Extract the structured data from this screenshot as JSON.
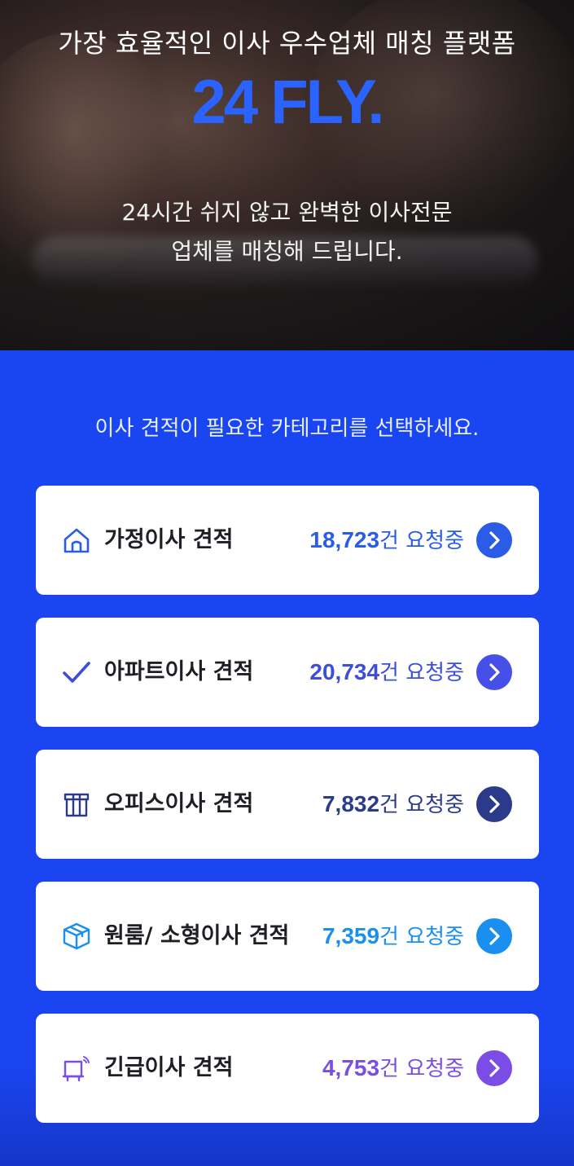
{
  "hero": {
    "tagline": "가장 효율적인 이사 우수업체 매칭 플랫폼",
    "logo": "24 FLY.",
    "description_line1": "24시간 쉬지 않고 완벽한 이사전문",
    "description_line2": "업체를 매칭해 드립니다."
  },
  "section": {
    "title": "이사 견적이 필요한 카테고리를 선택하세요."
  },
  "categories": [
    {
      "label": "가정이사 견적",
      "count": "18,723",
      "unit": "건 요청중",
      "icon": "house-icon",
      "color": "#2a5ce8",
      "arrow_color": "#2a5ce8"
    },
    {
      "label": "아파트이사 견적",
      "count": "20,734",
      "unit": "건 요청중",
      "icon": "check-icon",
      "color": "#3d4fd8",
      "arrow_color": "#4650e6"
    },
    {
      "label": "오피스이사 견적",
      "count": "7,832",
      "unit": "건 요청중",
      "icon": "gift-box-icon",
      "color": "#2c3a8c",
      "arrow_color": "#2c3a8c"
    },
    {
      "label": "원룸/ 소형이사 견적",
      "count": "7,359",
      "unit": "건 요청중",
      "icon": "package-box-icon",
      "color": "#1a8ff0",
      "arrow_color": "#1a8ff0"
    },
    {
      "label": "긴급이사 견적",
      "count": "4,753",
      "unit": "건 요청중",
      "icon": "urgent-truck-icon",
      "color": "#7a4ee6",
      "arrow_color": "#7a4ee6"
    }
  ]
}
